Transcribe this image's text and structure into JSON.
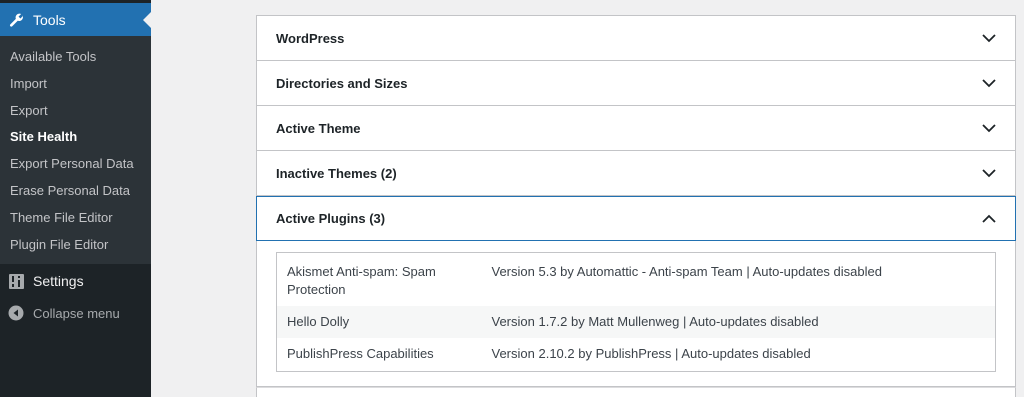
{
  "sidebar": {
    "menu_title": "Tools",
    "submenu": [
      {
        "label": "Available Tools",
        "current": false
      },
      {
        "label": "Import",
        "current": false
      },
      {
        "label": "Export",
        "current": false
      },
      {
        "label": "Site Health",
        "current": true
      },
      {
        "label": "Export Personal Data",
        "current": false
      },
      {
        "label": "Erase Personal Data",
        "current": false
      },
      {
        "label": "Theme File Editor",
        "current": false
      },
      {
        "label": "Plugin File Editor",
        "current": false
      }
    ],
    "settings_label": "Settings",
    "collapse_label": "Collapse menu"
  },
  "accordion": {
    "sections": [
      {
        "title": "WordPress",
        "expanded": false
      },
      {
        "title": "Directories and Sizes",
        "expanded": false
      },
      {
        "title": "Active Theme",
        "expanded": false
      },
      {
        "title": "Inactive Themes (2)",
        "expanded": false
      },
      {
        "title": "Active Plugins (3)",
        "expanded": true
      }
    ],
    "plugins": [
      {
        "name": "Akismet Anti-spam: Spam Protection",
        "value": "Version 5.3 by Automattic - Anti-spam Team | Auto-updates disabled"
      },
      {
        "name": "Hello Dolly",
        "value": "Version 1.7.2 by Matt Mullenweg | Auto-updates disabled"
      },
      {
        "name": "PublishPress Capabilities",
        "value": "Version 2.10.2 by PublishPress | Auto-updates disabled"
      }
    ]
  },
  "colors": {
    "sidebar_bg": "#1d2327",
    "submenu_bg": "#2c3338",
    "accent": "#2271b1",
    "page_bg": "#f0f0f1"
  },
  "icons": {
    "tools": "wrench-icon",
    "settings": "settings-sliders-icon",
    "collapse": "collapse-arrow-icon",
    "chevron_collapsed": "chevron-down-icon",
    "chevron_expanded": "chevron-up-icon"
  }
}
